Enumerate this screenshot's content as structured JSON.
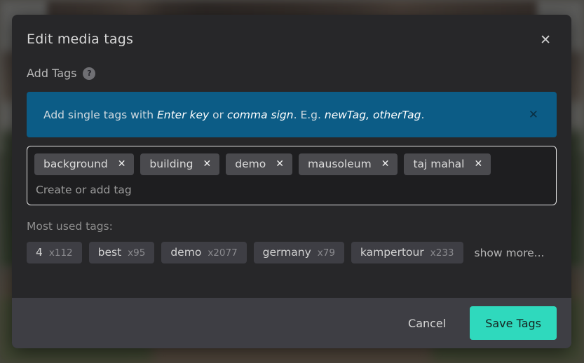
{
  "dialog": {
    "title": "Edit media tags",
    "close_icon": "close-icon",
    "field_label": "Add Tags",
    "help_icon": "?"
  },
  "info_banner": {
    "text_part1": "Add single tags with ",
    "em1": "Enter key",
    "text_part2": " or ",
    "em2": "comma sign",
    "text_part3": ". E.g. ",
    "em3": "newTag, otherTag",
    "text_part4": ".",
    "close_icon": "close-icon",
    "background_color": "#0c5c86"
  },
  "tag_input": {
    "placeholder": "Create or add tag",
    "value": "",
    "remove_icon": "close-icon",
    "tags": [
      {
        "label": "background"
      },
      {
        "label": "building"
      },
      {
        "label": "demo"
      },
      {
        "label": "mausoleum"
      },
      {
        "label": "taj mahal"
      }
    ]
  },
  "most_used": {
    "label": "Most used tags:",
    "chips": [
      {
        "name": "4",
        "count": "x112"
      },
      {
        "name": "best",
        "count": "x95"
      },
      {
        "name": "demo",
        "count": "x2077"
      },
      {
        "name": "germany",
        "count": "x79"
      },
      {
        "name": "kampertour",
        "count": "x233"
      }
    ],
    "show_more": "show more..."
  },
  "footer": {
    "cancel_label": "Cancel",
    "save_label": "Save Tags",
    "save_color": "#2fd9bd"
  }
}
